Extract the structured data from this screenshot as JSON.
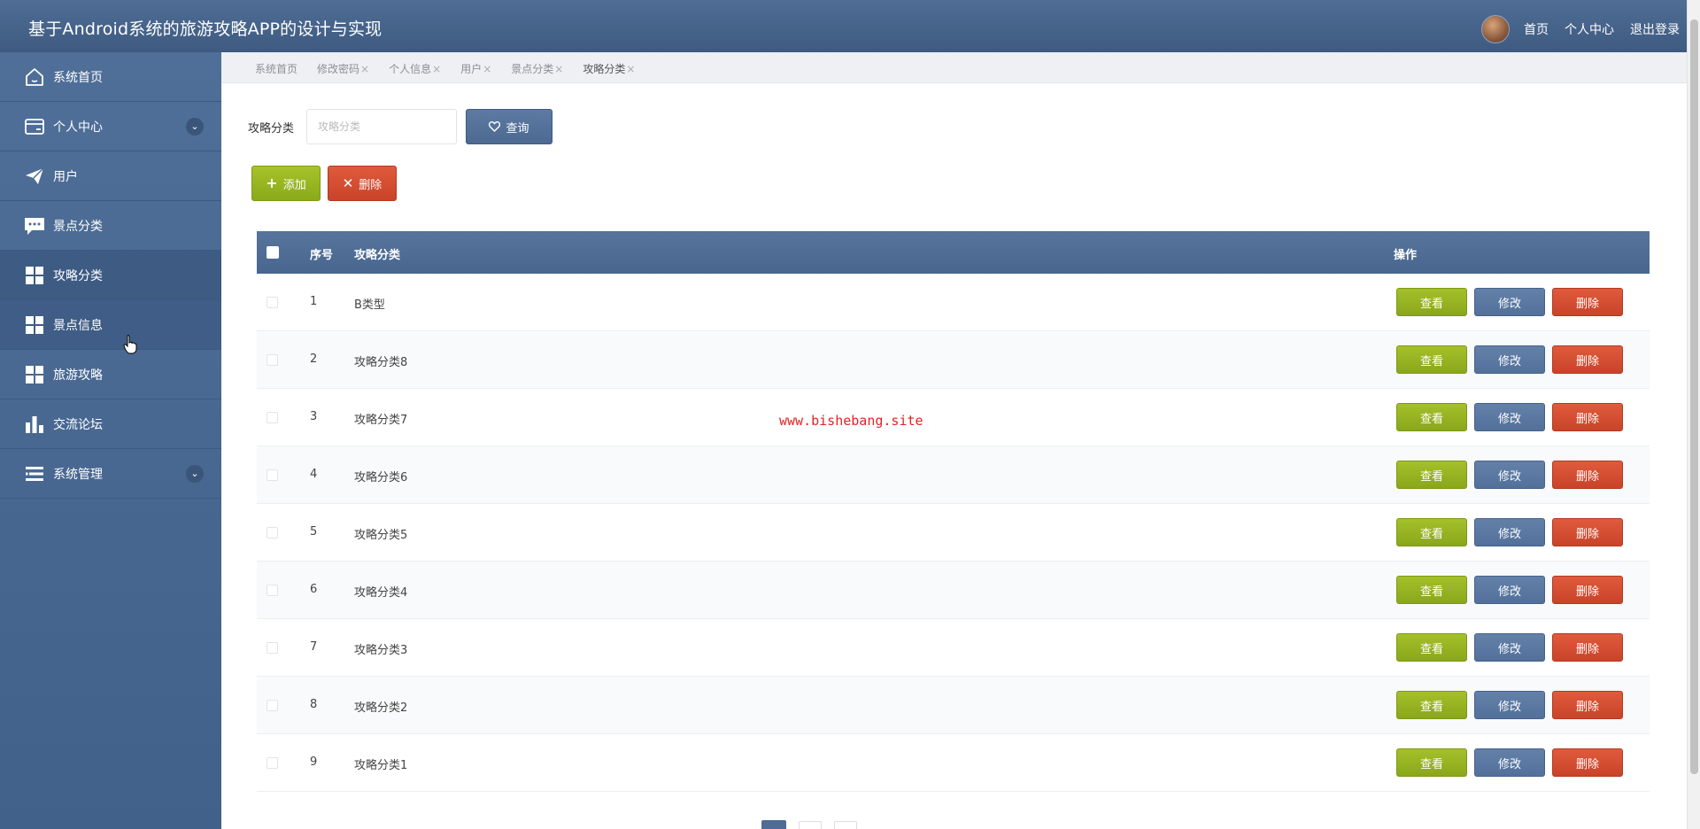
{
  "header": {
    "title": "基于Android系统的旅游攻略APP的设计与实现",
    "links": [
      "首页",
      "个人中心",
      "退出登录"
    ]
  },
  "sidebar": {
    "items": [
      {
        "label": "系统首页",
        "icon": "home-icon"
      },
      {
        "label": "个人中心",
        "icon": "card-icon",
        "expandable": true
      },
      {
        "label": "用户",
        "icon": "paper-plane-icon"
      },
      {
        "label": "景点分类",
        "icon": "chat-icon"
      },
      {
        "label": "攻略分类",
        "icon": "grid-icon"
      },
      {
        "label": "景点信息",
        "icon": "grid-icon"
      },
      {
        "label": "旅游攻略",
        "icon": "grid-icon"
      },
      {
        "label": "交流论坛",
        "icon": "bar-chart-icon"
      },
      {
        "label": "系统管理",
        "icon": "list-icon",
        "expandable": true
      }
    ]
  },
  "tabs": [
    {
      "label": "系统首页",
      "closable": false
    },
    {
      "label": "修改密码",
      "closable": true
    },
    {
      "label": "个人信息",
      "closable": true
    },
    {
      "label": "用户",
      "closable": true
    },
    {
      "label": "景点分类",
      "closable": true
    },
    {
      "label": "攻略分类",
      "closable": true
    }
  ],
  "tab_close": "×",
  "search": {
    "label": "攻略分类",
    "placeholder": "攻略分类",
    "value": "",
    "query_label": "查询"
  },
  "actions": {
    "add_label": "添加",
    "delete_label": "删除"
  },
  "table": {
    "columns": [
      "序号",
      "攻略分类",
      "操作"
    ],
    "row_actions": {
      "view": "查看",
      "edit": "修改",
      "delete": "删除"
    },
    "rows": [
      {
        "seq": "1",
        "name": "B类型"
      },
      {
        "seq": "2",
        "name": "攻略分类8"
      },
      {
        "seq": "3",
        "name": "攻略分类7"
      },
      {
        "seq": "4",
        "name": "攻略分类6"
      },
      {
        "seq": "5",
        "name": "攻略分类5"
      },
      {
        "seq": "6",
        "name": "攻略分类4"
      },
      {
        "seq": "7",
        "name": "攻略分类3"
      },
      {
        "seq": "8",
        "name": "攻略分类2"
      },
      {
        "seq": "9",
        "name": "攻略分类1"
      }
    ]
  },
  "watermark": "www.bishebang.site",
  "colors": {
    "header": "#46648c",
    "sidebar": "#4a6a94",
    "view_button": "#98b522",
    "edit_button": "#5a78a0",
    "delete_button": "#d44d33",
    "watermark": "#e02424"
  }
}
